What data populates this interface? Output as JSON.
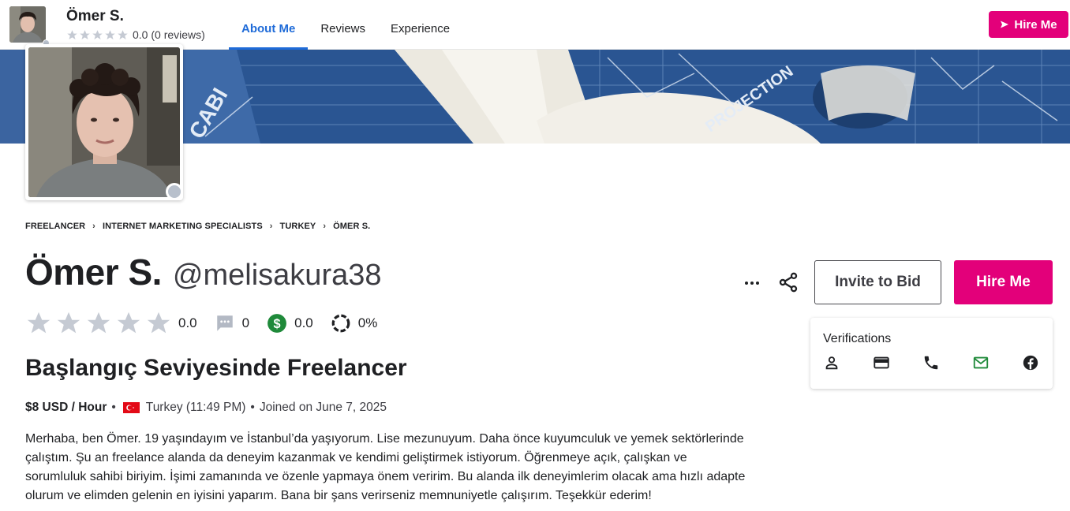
{
  "topbar": {
    "name": "Ömer S.",
    "rating_text": "0.0 (0 reviews)",
    "tabs": [
      {
        "label": "About Me",
        "active": true
      },
      {
        "label": "Reviews",
        "active": false
      },
      {
        "label": "Experience",
        "active": false
      }
    ],
    "hire_label": "Hire Me"
  },
  "breadcrumb": [
    "FREELANCER",
    "INTERNET MARKETING SPECIALISTS",
    "TURKEY",
    "ÖMER S."
  ],
  "profile": {
    "name": "Ömer S.",
    "handle": "@melisakura38",
    "rating": "0.0",
    "reviews": "0",
    "earnings": "0.0",
    "completion": "0%",
    "headline": "Başlangıç Seviyesinde Freelancer",
    "rate": "$8 USD / Hour",
    "location": "Turkey (11:49 PM)",
    "joined": "Joined on June 7, 2025",
    "bio": "Merhaba, ben Ömer. 19 yaşındayım ve İstanbul’da yaşıyorum. Lise mezunuyum. Daha önce kuyumculuk ve yemek sektörlerinde çalıştım. Şu an freelance alanda da deneyim kazanmak ve kendimi geliştirmek istiyorum. Öğrenmeye açık, çalışkan ve sorumluluk sahibi biriyim. İşimi zamanında ve özenle yapmaya önem veririm. Bu alanda ilk deneyimlerim olacak ama hızlı adapte olurum ve elimden gelenin en iyisini yaparım. Bana bir şans verirseniz memnuniyetle çalışırım. Teşekkür ederim!"
  },
  "actions": {
    "invite_label": "Invite to Bid",
    "hire_label": "Hire Me"
  },
  "verifications": {
    "title": "Verifications",
    "items": [
      {
        "icon": "person-icon",
        "verified": false
      },
      {
        "icon": "credit-card-icon",
        "verified": false
      },
      {
        "icon": "phone-icon",
        "verified": false
      },
      {
        "icon": "email-icon",
        "verified": true
      },
      {
        "icon": "facebook-icon",
        "verified": false
      }
    ]
  },
  "colors": {
    "accent_blue": "#1f6bd8",
    "hire_pink": "#e3007a",
    "star_gray": "#c5cad3",
    "verified_green": "#1f8a3a",
    "earnings_green": "#1f8a3a"
  }
}
